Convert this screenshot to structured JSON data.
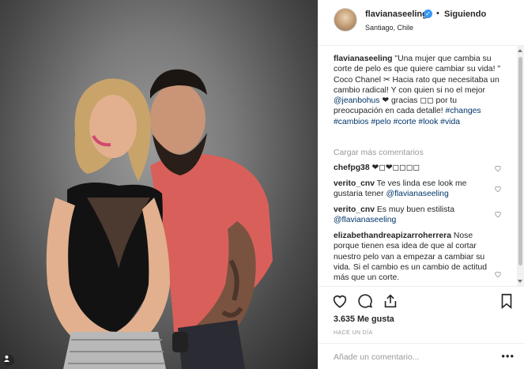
{
  "post": {
    "username": "flavianaseeling",
    "follow_label": "Siguiendo",
    "separator": "•",
    "location": "Santiago, Chile"
  },
  "caption": {
    "username": "flavianaseeling",
    "text1": " \"Una mujer que cambia su corte de pelo es que quiere cambiar su vida! \" Coco Chanel ✂ Hacia rato que necesitaba un cambio radical! Y con quien si no el mejor ",
    "mention": "@jeanbohus",
    "text2": " ❤ gracias ◻◻ por tu preocupación en cada detalle! ",
    "hashtags": "#changes #cambios #pelo #corte #look #vida"
  },
  "load_more": "Cargar más comentarios",
  "comments": [
    {
      "user": "chefpg38",
      "text": " ❤◻❤◻◻◻◻"
    },
    {
      "user": "verito_cnv",
      "text": " Te ves linda ese look me gustaria tener ",
      "mention": "@flavianaseeling"
    },
    {
      "user": "verito_cnv",
      "text": " Es muy buen estilista ",
      "mention": "@flavianaseeling"
    },
    {
      "user": "elizabethandreapizarroherrera",
      "text": " Nose porque tienen esa idea de que al cortar nuestro pelo van a empezar a cambiar su vida. Si el cambio es un cambio de actitud más que un corte."
    }
  ],
  "likes": "3.635 Me gusta",
  "time": "HACE UN DÍA",
  "add_comment_placeholder": "Añade un comentario...",
  "more_options": "•••",
  "icons": {
    "verified": "verified-badge-icon",
    "like": "heart-icon",
    "comment": "comment-icon",
    "share": "share-icon",
    "save": "bookmark-icon",
    "tagged": "user-tag-icon"
  },
  "colors": {
    "link": "#003569",
    "muted": "#999999",
    "verified": "#3897f0",
    "border": "#efefef"
  }
}
